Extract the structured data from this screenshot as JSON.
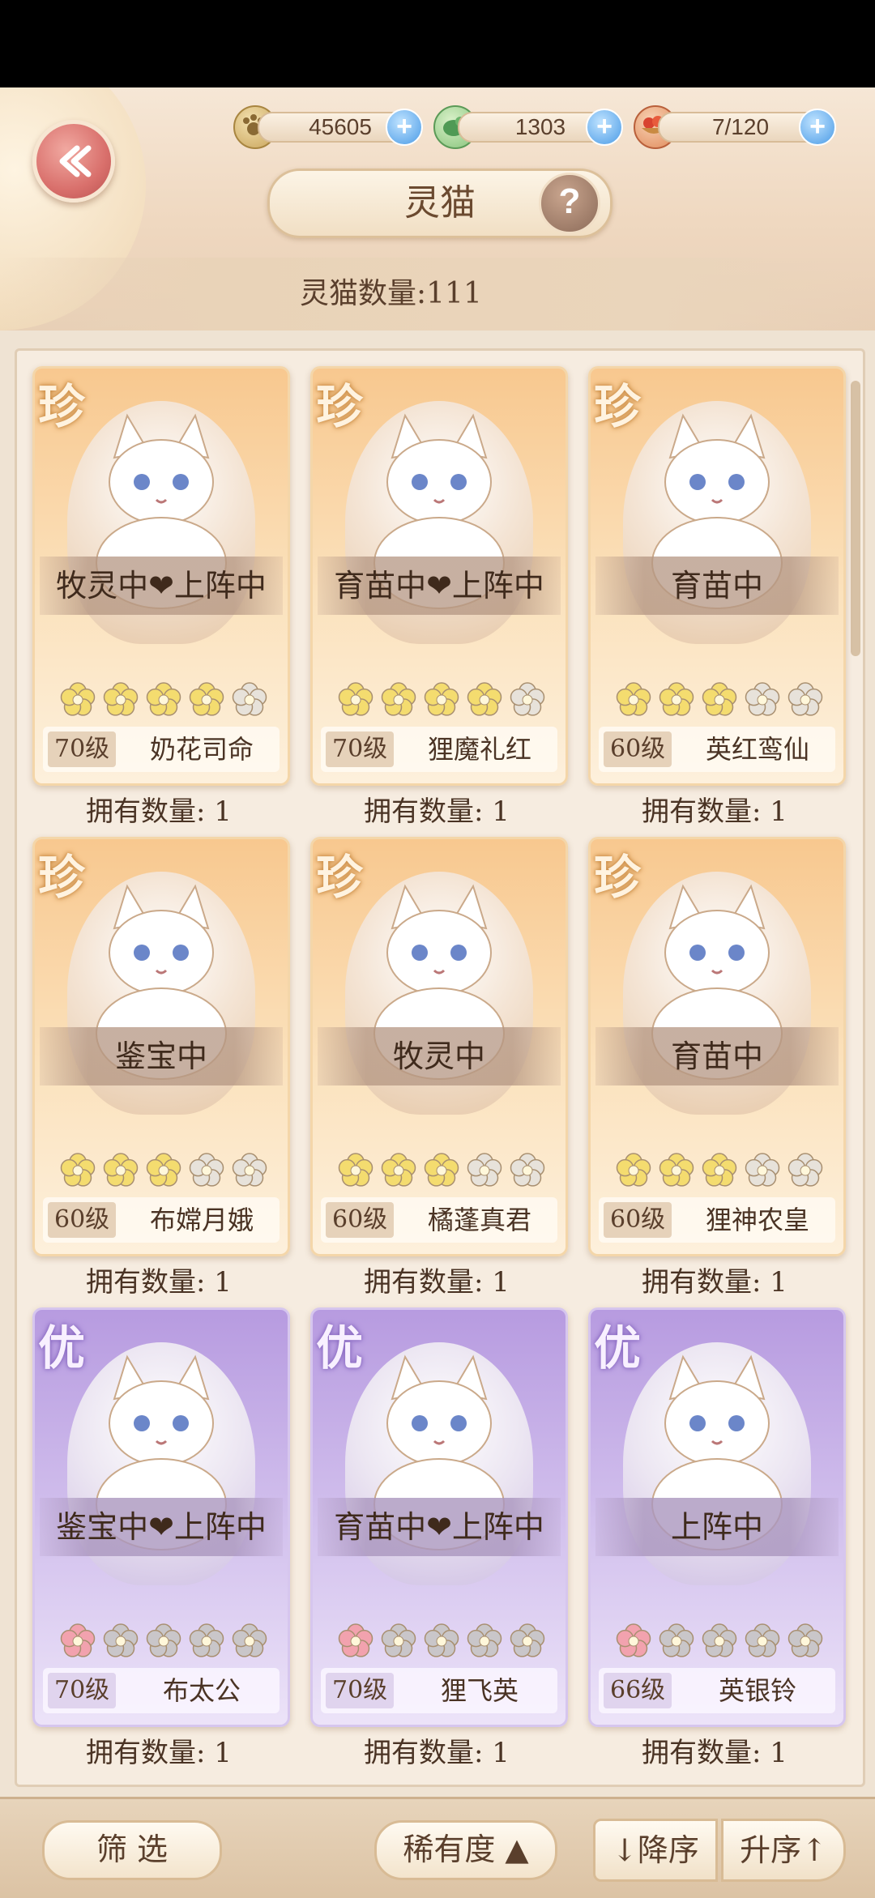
{
  "header": {
    "title": "灵猫",
    "help_label": "?",
    "cat_count_label": "灵猫数量:111"
  },
  "currencies": [
    {
      "name": "paw-coin",
      "value": "45605",
      "plus": "+"
    },
    {
      "name": "green-bird",
      "value": "1303",
      "plus": "+"
    },
    {
      "name": "fruit-bowl",
      "value": "7/120",
      "plus": "+"
    }
  ],
  "cards": [
    {
      "rarity": "珍",
      "status": "牧灵中❤上阵中",
      "level": "70级",
      "name": "奶花司命",
      "stars": 4,
      "owned": "拥有数量: 1"
    },
    {
      "rarity": "珍",
      "status": "育苗中❤上阵中",
      "level": "70级",
      "name": "狸魔礼红",
      "stars": 4,
      "owned": "拥有数量: 1"
    },
    {
      "rarity": "珍",
      "status": "育苗中",
      "level": "60级",
      "name": "英红鸾仙",
      "stars": 3,
      "owned": "拥有数量: 1"
    },
    {
      "rarity": "珍",
      "status": "鉴宝中",
      "level": "60级",
      "name": "布嫦月娥",
      "stars": 3,
      "owned": "拥有数量: 1"
    },
    {
      "rarity": "珍",
      "status": "牧灵中",
      "level": "60级",
      "name": "橘蓬真君",
      "stars": 3,
      "owned": "拥有数量: 1"
    },
    {
      "rarity": "珍",
      "status": "育苗中",
      "level": "60级",
      "name": "狸神农皇",
      "stars": 3,
      "owned": "拥有数量: 1"
    },
    {
      "rarity": "优",
      "status": "鉴宝中❤上阵中",
      "level": "70级",
      "name": "布太公",
      "stars": 1,
      "owned": "拥有数量: 1"
    },
    {
      "rarity": "优",
      "status": "育苗中❤上阵中",
      "level": "70级",
      "name": "狸飞英",
      "stars": 1,
      "owned": "拥有数量: 1"
    },
    {
      "rarity": "优",
      "status": "上阵中",
      "level": "66级",
      "name": "英银铃",
      "stars": 1,
      "owned": "拥有数量: 1"
    }
  ],
  "bottom": {
    "filter_label": "筛 选",
    "sort_by_label": "稀有度 ▲",
    "desc_label": "↓降序",
    "asc_label": "升序↑"
  },
  "colors": {
    "gold_star": "#f4dc6f",
    "empty_star": "#e7e2da",
    "pink_star": "#f2a2ae",
    "gray_star": "#c9c6c9"
  }
}
